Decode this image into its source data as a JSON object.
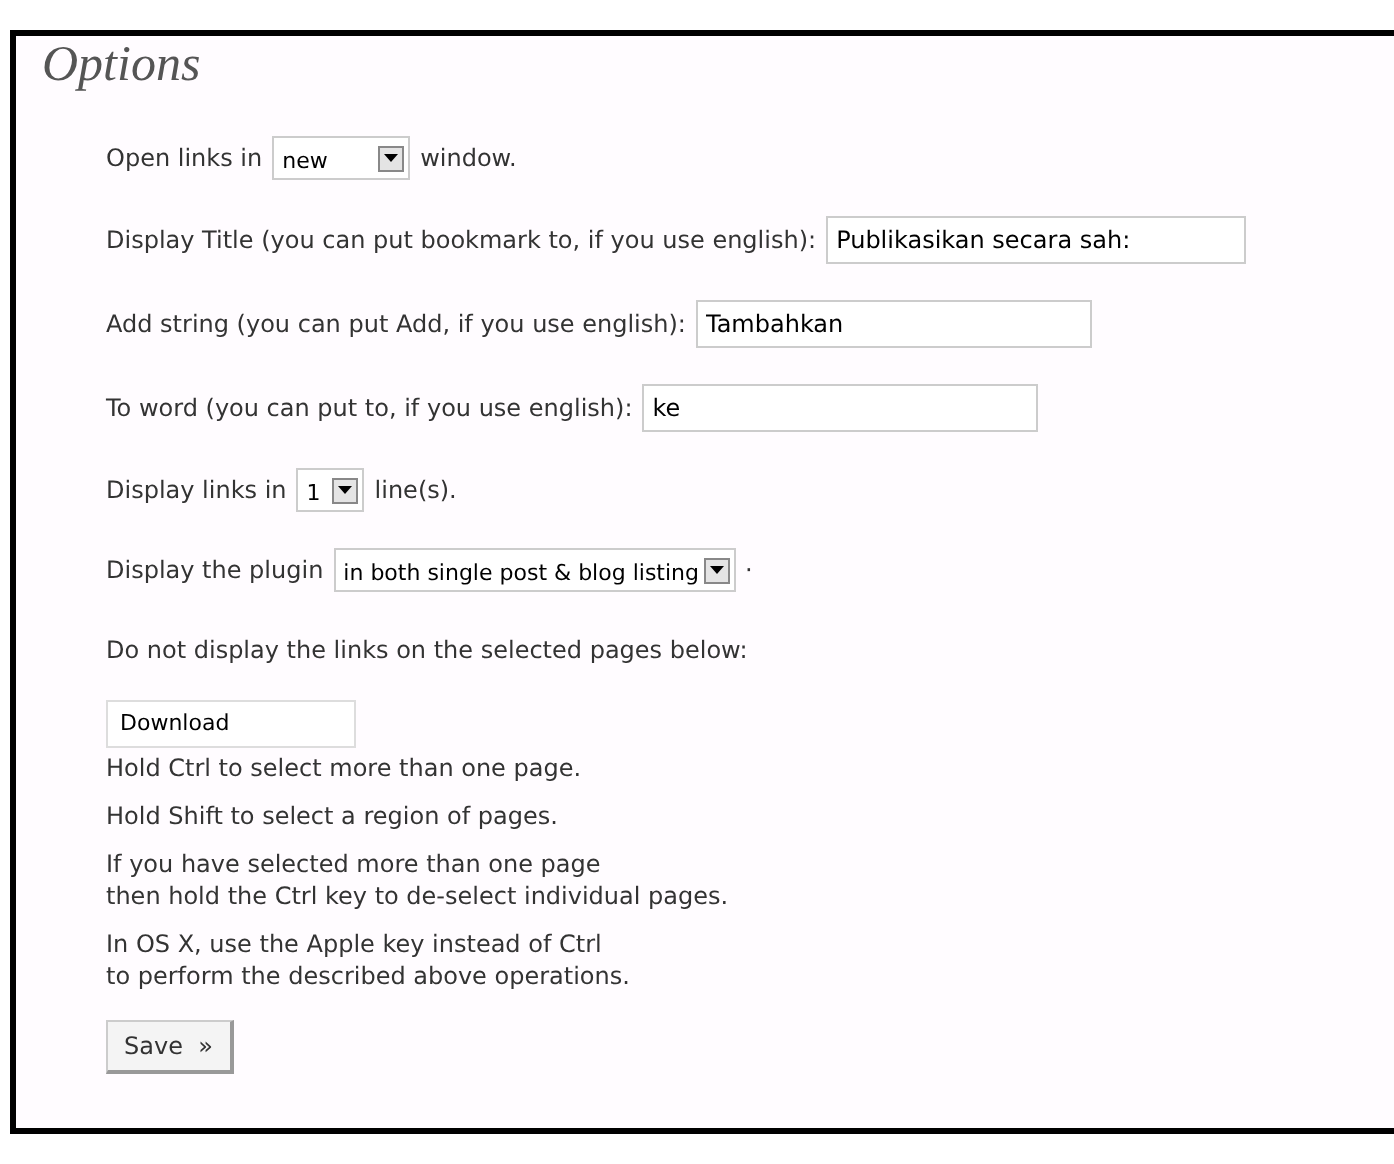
{
  "panel": {
    "title": "Options",
    "rows": [
      {
        "kind": "select",
        "label": "Open links in",
        "value": "new",
        "suffix": "window."
      },
      {
        "kind": "text",
        "label": "Display Title (you can put bookmark to, if you use english):",
        "value": "Publikasikan secara sah:"
      },
      {
        "kind": "text",
        "label": "Add string (you can put Add, if you use english):",
        "value": "Tambahkan"
      },
      {
        "kind": "text",
        "label": "To word (you can put to, if you use english):",
        "value": "ke"
      },
      {
        "kind": "select",
        "label": "Display links in",
        "value": "1",
        "suffix": "line(s)."
      },
      {
        "kind": "select",
        "label": "Display the plugin",
        "value": "in both single post & blog listing",
        "suffix": "·"
      },
      {
        "kind": "note",
        "label": "Do not display the links on the selected pages below:"
      }
    ],
    "pages_list": {
      "items": [
        {
          "label": "Download",
          "selected": false
        }
      ]
    },
    "hints": [
      "Hold Ctrl to select more than one page.",
      "Hold Shift to select a region of pages.",
      "If you have selected more than one page\nthen hold the Ctrl key to de-select individual pages.",
      "In OS X, use the Apple key instead of Ctrl\nto perform the described above operations."
    ],
    "save_button": "Save  »"
  }
}
